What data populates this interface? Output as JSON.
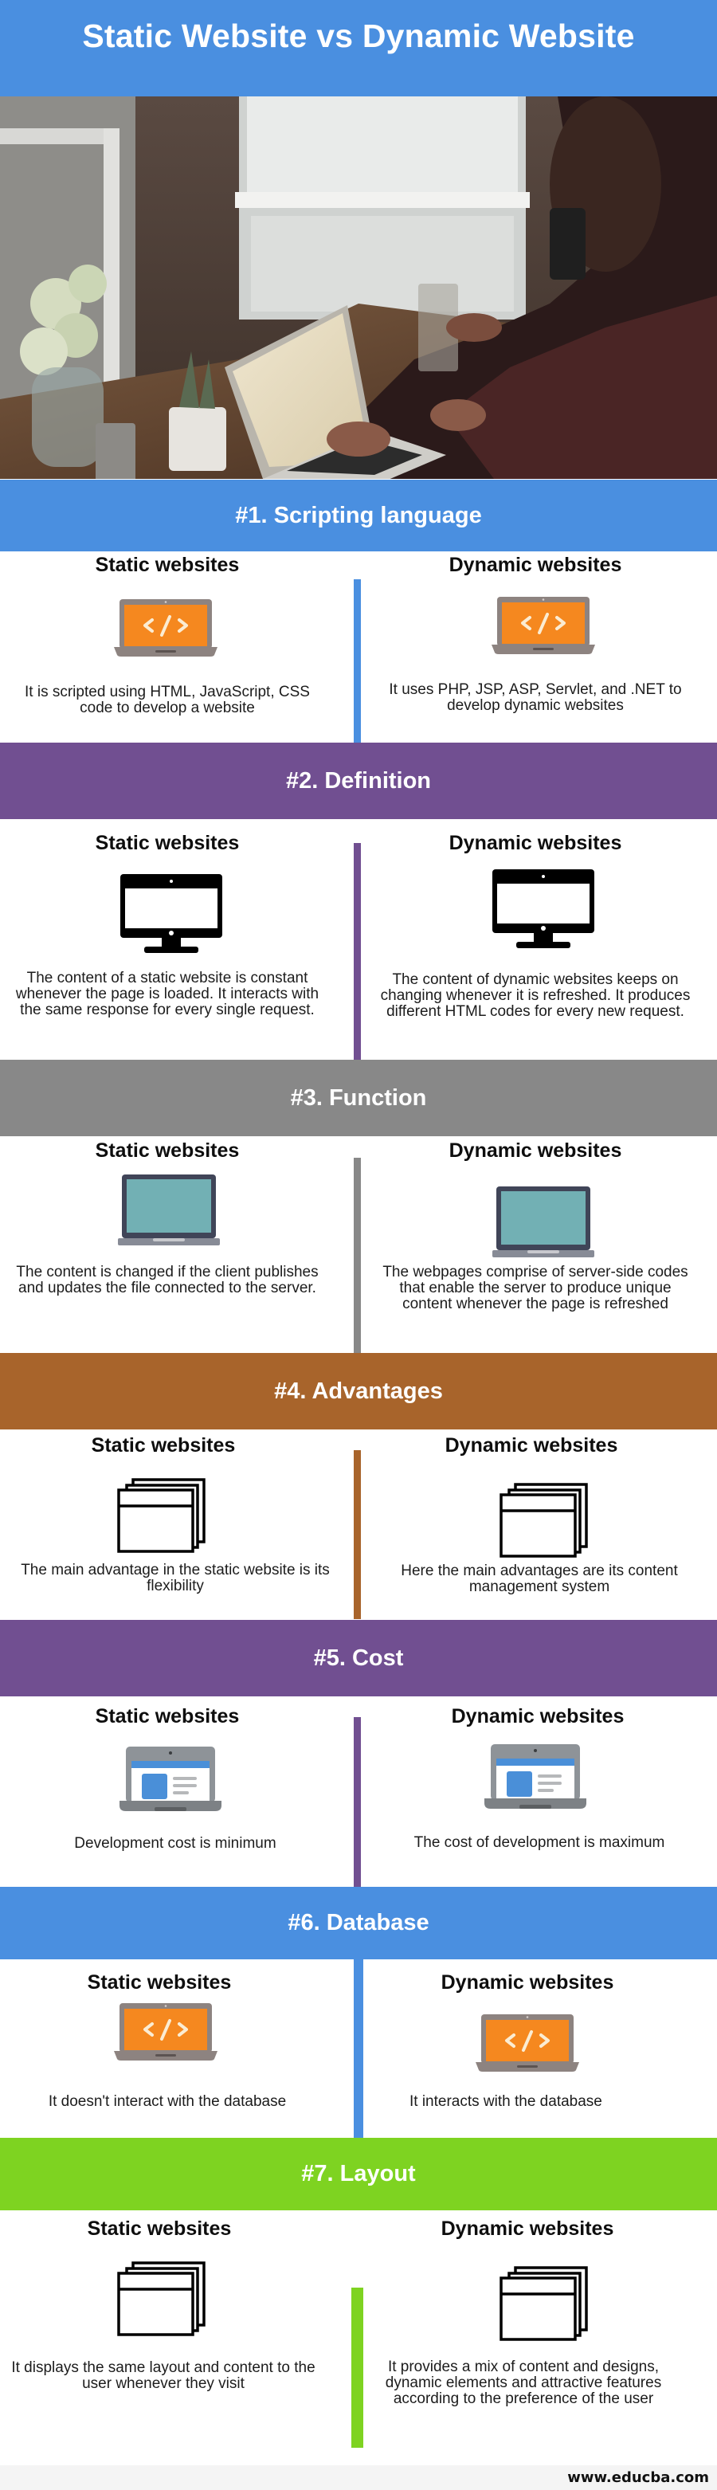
{
  "header": {
    "title": "Static Website vs Dynamic Website",
    "color": "#4a8fe0"
  },
  "hero_image": {
    "description": "Person typing on a laptop at a wooden table with flowers and a plant"
  },
  "column_labels": {
    "static": "Static websites",
    "dynamic": "Dynamic websites"
  },
  "sections": [
    {
      "title": "#1. Scripting language",
      "color": "#4a8fe0",
      "icon": "code-laptop-icon",
      "static_text": "It is scripted using HTML, JavaScript, CSS code to develop a website",
      "dynamic_text": "It uses PHP, JSP, ASP, Servlet, and .NET to develop dynamic websites"
    },
    {
      "title": "#2. Definition",
      "color": "#714f91",
      "icon": "monitor-icon",
      "static_text": "The content of a static website is constant whenever the page is loaded. It interacts with the same response for every single request.",
      "dynamic_text": "The content of dynamic websites keeps on changing whenever it is refreshed. It produces different HTML codes for every new request."
    },
    {
      "title": "#3. Function",
      "color": "#888888",
      "icon": "teal-laptop-icon",
      "static_text": "The content is changed if the client publishes and updates the file connected to the server.",
      "dynamic_text": "The webpages comprise of server-side codes that enable the server to produce unique content whenever the page is refreshed"
    },
    {
      "title": "#4. Advantages",
      "color": "#a8642b",
      "icon": "stacked-windows-icon",
      "static_text": "The main advantage in the static website is its flexibility",
      "dynamic_text": "Here the main advantages are its content management system"
    },
    {
      "title": "#5. Cost",
      "color": "#714f91",
      "icon": "webpage-laptop-icon",
      "static_text": "Development cost is minimum",
      "dynamic_text": "The cost of development is maximum"
    },
    {
      "title": "#6. Database",
      "color": "#4a8fe0",
      "icon": "code-laptop-icon",
      "static_text": "It doesn't interact with the database",
      "dynamic_text": "It interacts with the database"
    },
    {
      "title": "#7. Layout",
      "color": "#7ed321",
      "icon": "stacked-windows-icon",
      "static_text": "It displays the same layout and content to the user whenever they visit",
      "dynamic_text": "It provides a mix of content and designs, dynamic elements and attractive features according to the preference of the user"
    }
  ],
  "footer": {
    "site": "www.educba.com"
  }
}
